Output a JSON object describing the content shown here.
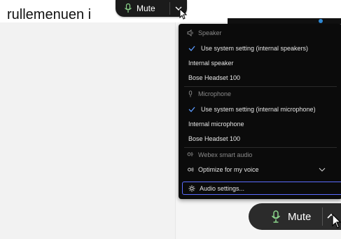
{
  "caption": {
    "text": "rullemenuen i"
  },
  "mini_mute_button": {
    "label": "Mute",
    "caret_icon": "chevron-down-icon"
  },
  "menu": {
    "speaker": {
      "header": "Speaker",
      "items": [
        "Use system setting (internal speakers)",
        "Internal speaker",
        "Bose Headset 100"
      ],
      "selected_index": 0
    },
    "microphone": {
      "header": "Microphone",
      "items": [
        "Use system setting (internal microphone)",
        "Internal microphone",
        "Bose Headset 100"
      ],
      "selected_index": 0
    },
    "smart_audio": {
      "header": "Webex smart audio",
      "option_label": "Optimize for my voice"
    },
    "audio_settings_label": "Audio settings..."
  },
  "big_mute_button": {
    "label": "Mute",
    "caret_icon": "chevron-up-icon"
  },
  "colors": {
    "menu_bg": "#0b0b0b",
    "focus_ring": "#5b6cff",
    "mic_green": "#8bd48b"
  }
}
